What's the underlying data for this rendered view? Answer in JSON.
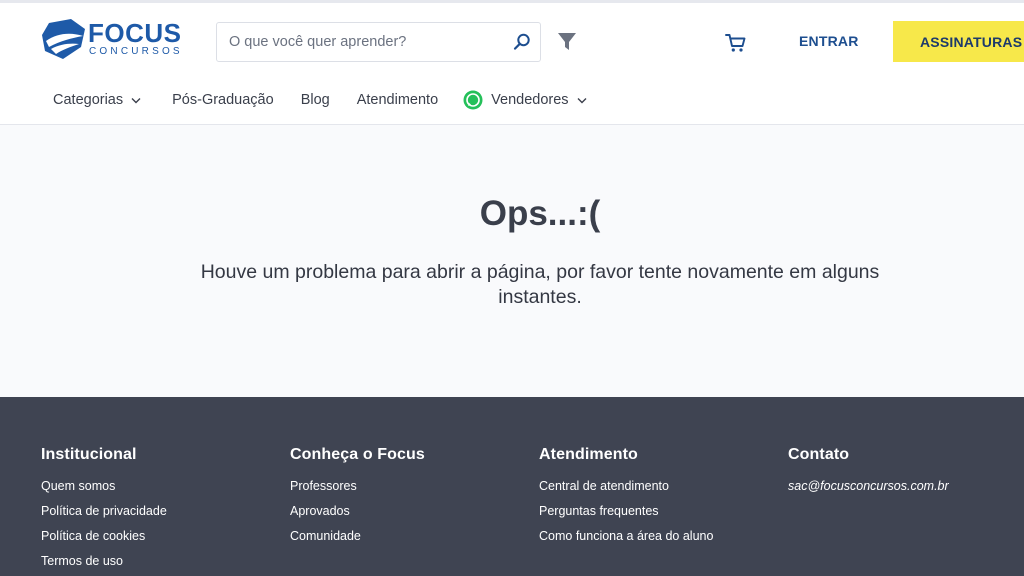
{
  "brand": {
    "name": "FOCUS",
    "subtitle": "CONCURSOS",
    "color": "#1e5aa8"
  },
  "search": {
    "placeholder": "O que você quer aprender?",
    "icon": "search-icon"
  },
  "header": {
    "filter_icon": "filter-icon",
    "cart_icon": "cart-icon",
    "login_label": "ENTRAR",
    "subscribe_label": "ASSINATURAS",
    "subscribe_color": "#f7e84a"
  },
  "nav": {
    "categorias": "Categorias",
    "pos": "Pós-Graduação",
    "blog": "Blog",
    "atendimento": "Atendimento",
    "vendedores": "Vendedores"
  },
  "error": {
    "title": "Ops...:(",
    "message": "Houve um problema para abrir a página, por favor tente novamente em alguns instantes."
  },
  "footer": {
    "background": "#3f4452",
    "columns": [
      {
        "title": "Institucional",
        "links": [
          "Quem somos",
          "Política de privacidade",
          "Política de cookies",
          "Termos de uso"
        ]
      },
      {
        "title": "Conheça o Focus",
        "links": [
          "Professores",
          "Aprovados",
          "Comunidade"
        ]
      },
      {
        "title": "Atendimento",
        "links": [
          "Central de atendimento",
          "Perguntas frequentes",
          "Como funciona a área do aluno"
        ]
      },
      {
        "title": "Contato",
        "links": [
          "sac@focusconcursos.com.br"
        ]
      }
    ]
  }
}
